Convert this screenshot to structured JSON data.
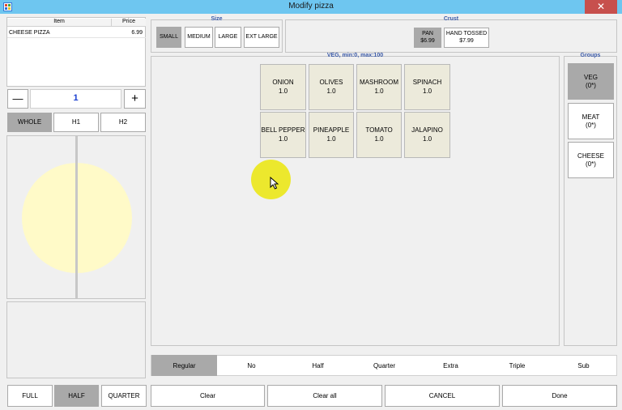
{
  "window": {
    "title": "Modify pizza",
    "close_glyph": "✕"
  },
  "order": {
    "columns": [
      "Item",
      "Price"
    ],
    "rows": [
      {
        "item": "CHEESE PIZZA",
        "price": "6.99"
      }
    ]
  },
  "quantity": {
    "minus_glyph": "—",
    "value": "1",
    "plus_glyph": "+"
  },
  "portion_tabs": [
    "WHOLE",
    "H1",
    "H2"
  ],
  "size": {
    "label": "Size",
    "options": [
      "SMALL",
      "MEDIUM",
      "LARGE",
      "EXT LARGE"
    ],
    "selected": "SMALL"
  },
  "crust": {
    "label": "Crust",
    "options": [
      {
        "name": "PAN",
        "price": "$6.99"
      },
      {
        "name": "HAND TOSSED",
        "price": "$7.99"
      }
    ],
    "selected": "PAN"
  },
  "toppings": {
    "label": "VEG, min:0, max:100",
    "items": [
      {
        "name": "ONION",
        "qty": "1.0"
      },
      {
        "name": "OLIVES",
        "qty": "1.0"
      },
      {
        "name": "MASHROOM",
        "qty": "1.0"
      },
      {
        "name": "SPINACH",
        "qty": "1.0"
      },
      {
        "name": "BELL PEPPER",
        "qty": "1.0"
      },
      {
        "name": "PINEAPPLE",
        "qty": "1.0"
      },
      {
        "name": "TOMATO",
        "qty": "1.0"
      },
      {
        "name": "JALAPINO",
        "qty": "1.0"
      }
    ]
  },
  "groups": {
    "label": "Groups",
    "items": [
      {
        "name": "VEG",
        "count": "(0*)"
      },
      {
        "name": "MEAT",
        "count": "(0*)"
      },
      {
        "name": "CHEESE",
        "count": "(0*)"
      }
    ],
    "selected": "VEG"
  },
  "modifiers": {
    "items": [
      "Regular",
      "No",
      "Half",
      "Quarter",
      "Extra",
      "Triple",
      "Sub"
    ],
    "selected": "Regular"
  },
  "coverage": {
    "items": [
      "FULL",
      "HALF",
      "QUARTER"
    ],
    "selected": "HALF"
  },
  "actions": {
    "clear": "Clear",
    "clear_all": "Clear all",
    "cancel": "CANCEL",
    "done": "Done"
  },
  "colors": {
    "titlebar": "#6ec6f0",
    "selected": "#a9a9a9",
    "tile": "#eceadb",
    "pizza": "#fffac8",
    "close": "#c7504d"
  }
}
